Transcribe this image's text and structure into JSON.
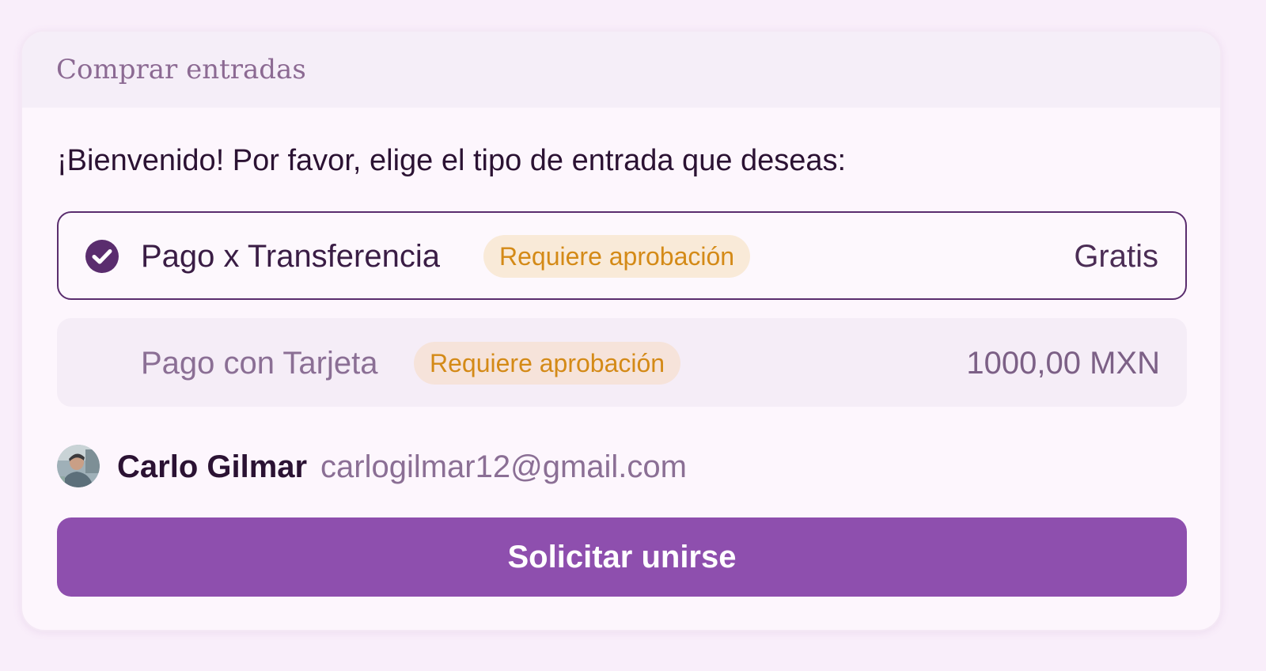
{
  "card": {
    "title": "Comprar entradas",
    "welcome": "¡Bienvenido! Por favor, elige el tipo de entrada que deseas:"
  },
  "tickets": [
    {
      "name": "Pago x Transferencia",
      "badge": "Requiere aprobación",
      "price": "Gratis",
      "selected": true,
      "icon": "check-circle-icon"
    },
    {
      "name": "Pago con Tarjeta",
      "badge": "Requiere aprobación",
      "price": "1000,00 MXN",
      "selected": false
    }
  ],
  "user": {
    "name": "Carlo Gilmar",
    "email": "carlogilmar12@gmail.com",
    "avatar_icon": "avatar-photo"
  },
  "join_button": {
    "label": "Solicitar unirse"
  },
  "colors": {
    "accent": "#8e4fae",
    "selected_border": "#5a2d6e",
    "badge_text": "#d48a17",
    "page_background": "#f9eefa"
  }
}
